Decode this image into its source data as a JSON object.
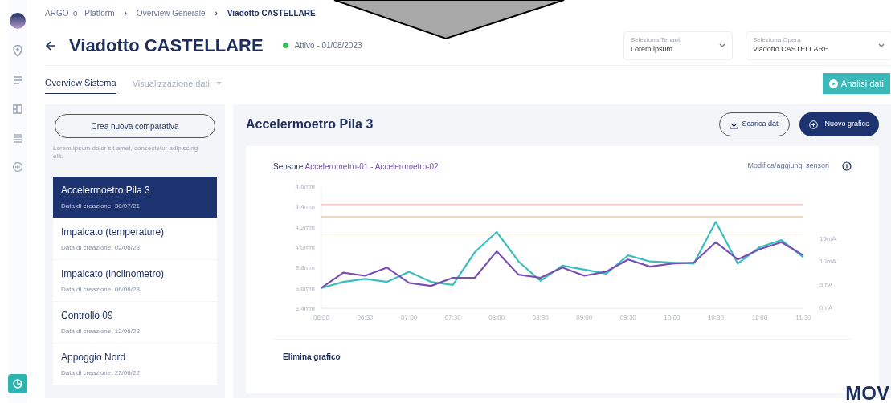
{
  "breadcrumb": [
    {
      "label": "ARGO IoT Platform",
      "current": false
    },
    {
      "label": "Overview Generale",
      "current": false
    },
    {
      "label": "Viadotto CASTELLARE",
      "current": true
    }
  ],
  "title": "Viadotto CASTELLARE",
  "status": {
    "label": "Attivo - 01/08/2023",
    "color": "#3fbf5a"
  },
  "selects": [
    {
      "label": "Seleziona Tenant",
      "value": "Lorem ipsum"
    },
    {
      "label": "Seleziona Opera",
      "value": "Viadotto CASTELLARE"
    }
  ],
  "tabs": [
    {
      "label": "Overview Sistema",
      "selected": true,
      "dropdown": false
    },
    {
      "label": "Visualizzazione dati",
      "selected": false,
      "dropdown": true
    }
  ],
  "analysis_button": "Analisi dati",
  "breadcrumb_separator": "›",
  "sidebar_rail": [
    {
      "kind": "pin",
      "selected": false
    },
    {
      "kind": "lines",
      "selected": false
    },
    {
      "kind": "layout",
      "selected": false
    },
    {
      "kind": "list",
      "selected": false
    },
    {
      "kind": "plus",
      "selected": false
    },
    {
      "kind": "pie",
      "selected": true
    }
  ],
  "compare_button": "Crea nuova comparativa",
  "compare_hint": "Lorem ipsum dolor sit amet, consectetur adipiscing elit.",
  "comparisons": [
    {
      "name": "Accelermoetro Pila 3",
      "date": "Data di creazione: 30/07/21",
      "selected": true
    },
    {
      "name": "Impalcato (temperature)",
      "date": "Data di creazione: 02/06/23",
      "selected": false
    },
    {
      "name": "Impalcato (inclinometro)",
      "date": "Data di creazione: 06/06/23",
      "selected": false
    },
    {
      "name": "Controllo 09",
      "date": "Data di creazione: 12/06/22",
      "selected": false
    },
    {
      "name": "Appoggio Nord",
      "date": "Data di creazione: 23/06/22",
      "selected": false
    }
  ],
  "panel": {
    "title": "Accelermoetro Pila 3",
    "download_button": "Scarica dati",
    "new_chart_button": "Nuovo grafico",
    "sensor_label": "Sensore",
    "sensor_separator": "-",
    "edit_link": "Modifica/aggiungi sensori",
    "right_axis_labels": [
      "15mA",
      "10mA",
      "5mA",
      "0mA"
    ],
    "delete_link": "Elimina grafico",
    "chart_data": {
      "type": "line",
      "x": [
        6,
        6.25,
        6.5,
        6.75,
        7,
        7.25,
        7.5,
        7.75,
        8,
        8.25,
        8.5,
        8.75,
        9,
        9.25,
        9.5,
        9.75,
        10,
        10.25,
        10.5,
        10.75,
        11,
        11.25,
        11.5
      ],
      "series": [
        {
          "name": "Accelerometro-01",
          "color": "#3cbdbd",
          "values": [
            3.6,
            3.66,
            3.69,
            3.66,
            3.76,
            3.66,
            3.63,
            3.95,
            4.15,
            3.86,
            3.67,
            3.82,
            3.78,
            3.74,
            3.92,
            3.86,
            3.85,
            3.84,
            4.25,
            3.84,
            4.0,
            4.07,
            3.9
          ]
        },
        {
          "name": "Accelerometro-02",
          "color": "#7a4fb5",
          "values": [
            3.6,
            3.75,
            3.72,
            3.8,
            3.65,
            3.62,
            3.7,
            3.7,
            3.96,
            3.73,
            3.7,
            3.8,
            3.72,
            3.76,
            3.88,
            3.81,
            3.84,
            3.85,
            4.05,
            3.88,
            3.98,
            4.05,
            3.92
          ]
        }
      ],
      "xlim": [
        6,
        11.5
      ],
      "ylim": [
        3.4,
        4.6
      ],
      "xticks": [
        {
          "value": 6,
          "label": "06:00"
        },
        {
          "value": 6.5,
          "label": "06:30"
        },
        {
          "value": 7,
          "label": "07:00"
        },
        {
          "value": 7.5,
          "label": "07:30"
        },
        {
          "value": 8,
          "label": "08:00"
        },
        {
          "value": 8.5,
          "label": "08:30"
        },
        {
          "value": 9,
          "label": "09:00"
        },
        {
          "value": 9.5,
          "label": "09:30"
        },
        {
          "value": 10,
          "label": "10:00"
        },
        {
          "value": 10.5,
          "label": "10:30"
        },
        {
          "value": 11,
          "label": "11:00"
        },
        {
          "value": 11.5,
          "label": "11:30"
        }
      ],
      "yticks": [
        {
          "value": 3.4,
          "label": "3.4mm"
        },
        {
          "value": 3.6,
          "label": "3.6mm"
        },
        {
          "value": 3.8,
          "label": "3.8mm"
        },
        {
          "value": 4.0,
          "label": "4.0mm"
        },
        {
          "value": 4.2,
          "label": "4.2mm"
        },
        {
          "value": 4.4,
          "label": "4.4mm"
        },
        {
          "value": 4.6,
          "label": "4.6mm"
        }
      ],
      "ref_lines": [
        {
          "axis": "y",
          "value": 4.42,
          "color": "#f2b8b8"
        },
        {
          "axis": "y",
          "value": 4.3,
          "color": "#f5c99a"
        },
        {
          "axis": "y",
          "value": 4.13,
          "color": "#f3dc9a"
        }
      ]
    }
  },
  "corner_text": "MOV"
}
